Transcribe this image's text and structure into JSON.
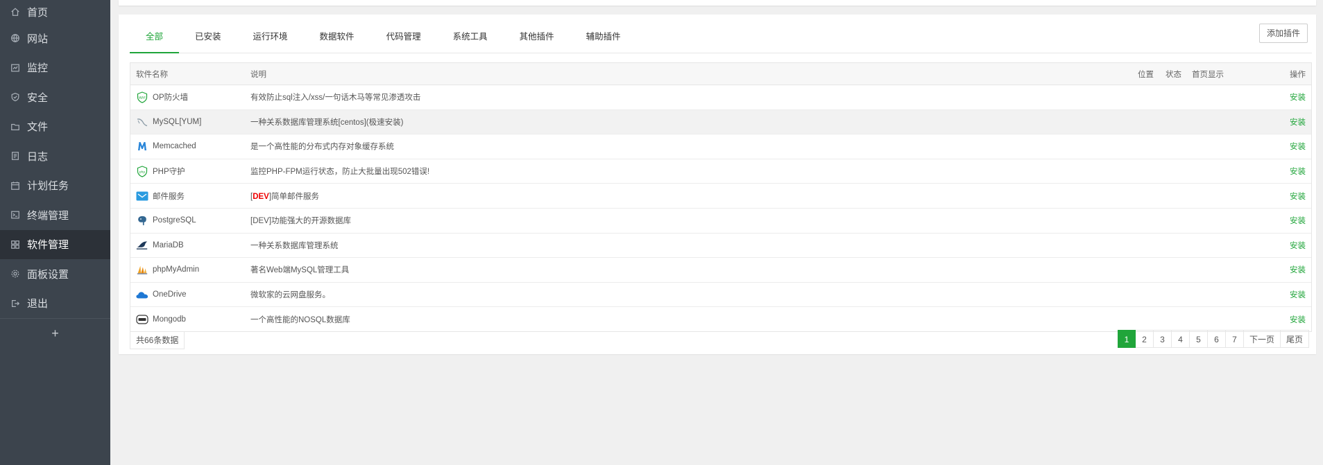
{
  "sidebar": {
    "items": [
      {
        "label": "首页",
        "icon": "home-icon"
      },
      {
        "label": "网站",
        "icon": "globe-icon"
      },
      {
        "label": "监控",
        "icon": "monitor-icon"
      },
      {
        "label": "安全",
        "icon": "shield-icon"
      },
      {
        "label": "文件",
        "icon": "folder-icon"
      },
      {
        "label": "日志",
        "icon": "log-icon"
      },
      {
        "label": "计划任务",
        "icon": "calendar-icon"
      },
      {
        "label": "终端管理",
        "icon": "terminal-icon"
      },
      {
        "label": "软件管理",
        "icon": "apps-icon"
      },
      {
        "label": "面板设置",
        "icon": "gear-icon"
      },
      {
        "label": "退出",
        "icon": "logout-icon"
      }
    ],
    "add_label": "+"
  },
  "tabs": [
    "全部",
    "已安装",
    "运行环境",
    "数据软件",
    "代码管理",
    "系统工具",
    "其他插件",
    "辅助插件"
  ],
  "add_plugin_label": "添加插件",
  "table": {
    "headers": {
      "name": "软件名称",
      "desc": "说明",
      "pos": "位置",
      "status": "状态",
      "home": "首页显示",
      "op": "操作"
    },
    "rows": [
      {
        "name": "OP防火墙",
        "desc": "有效防止sql注入/xss/一句话木马等常见渗透攻击",
        "op": "安装",
        "icon": "waf-shield-icon"
      },
      {
        "name": "MySQL[YUM]",
        "desc": "一种关系数据库管理系统[centos](极速安装)",
        "op": "安装",
        "icon": "mysql-icon"
      },
      {
        "name": "Memcached",
        "desc": "是一个高性能的分布式内存对象缓存系统",
        "op": "安装",
        "icon": "memcached-icon"
      },
      {
        "name": "PHP守护",
        "desc": "监控PHP-FPM运行状态，防止大批量出现502错误!",
        "op": "安装",
        "icon": "php-shield-icon"
      },
      {
        "name": "邮件服务",
        "desc_pre": "[",
        "desc_tag": "DEV",
        "desc_post": "]简单邮件服务",
        "op": "安装",
        "icon": "mail-icon"
      },
      {
        "name": "PostgreSQL",
        "desc": "[DEV]功能强大的开源数据库",
        "op": "安装",
        "icon": "postgresql-icon"
      },
      {
        "name": "MariaDB",
        "desc": "一种关系数据库管理系统",
        "op": "安装",
        "icon": "mariadb-icon"
      },
      {
        "name": "phpMyAdmin",
        "desc": "著名Web端MySQL管理工具",
        "op": "安装",
        "icon": "phpmyadmin-icon"
      },
      {
        "name": "OneDrive",
        "desc": "微软家的云网盘服务。",
        "op": "安装",
        "icon": "onedrive-icon"
      },
      {
        "name": "Mongodb",
        "desc": "一个高性能的NOSQL数据库",
        "op": "安装",
        "icon": "mongodb-icon"
      }
    ]
  },
  "total_label": "共66条数据",
  "pagination": {
    "pages": [
      "1",
      "2",
      "3",
      "4",
      "5",
      "6",
      "7"
    ],
    "next": "下一页",
    "last": "尾页"
  },
  "colors": {
    "accent": "#20a53a",
    "sidebar_bg": "#3c444d",
    "dev_tag": "#ee0000"
  }
}
